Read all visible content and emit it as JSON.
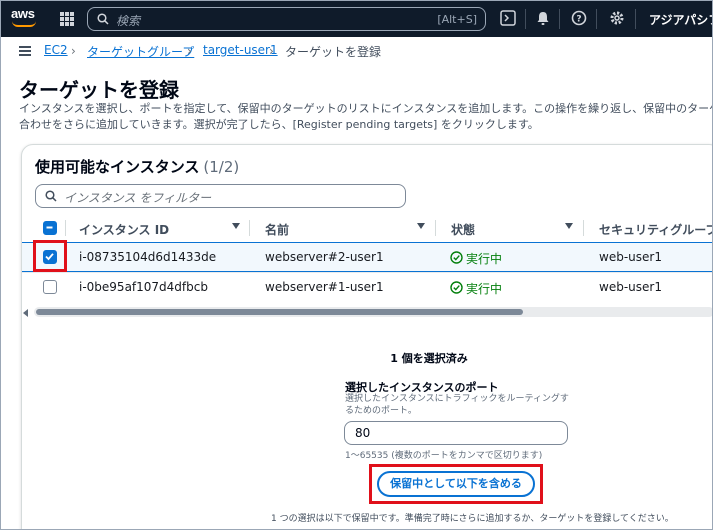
{
  "nav": {
    "logo": "aws",
    "search_placeholder": "検索",
    "search_shortcut": "[Alt+S]",
    "region": "アジアパシフィ"
  },
  "breadcrumb": [
    "EC2",
    "ターゲットグループ",
    "target-user1",
    "ターゲットを登録"
  ],
  "page": {
    "title": "ターゲットを登録",
    "desc_line1": "インスタンスを選択し、ポートを指定して、保留中のターゲットのリストにインスタンスを追加します。この操作を繰り返し、保留中のターゲットの",
    "desc_line2": "合わせをさらに追加していきます。選択が完了したら、[Register pending targets] をクリックします。"
  },
  "panel": {
    "title": "使用可能なインスタンス",
    "count": "(1/2)",
    "filter_placeholder": "インスタンス をフィルター"
  },
  "table": {
    "headers": [
      "インスタンス ID",
      "名前",
      "状態",
      "セキュリティグループ"
    ],
    "rows": [
      {
        "id": "i-08735104d6d1433de",
        "name": "webserver#2-user1",
        "state": "実行中",
        "sg": "web-user1",
        "selected": true
      },
      {
        "id": "i-0be95af107d4dfbcb",
        "name": "webserver#1-user1",
        "state": "実行中",
        "sg": "web-user1",
        "selected": false
      }
    ]
  },
  "selection": {
    "count_text": "1 個を選択済み",
    "port_label": "選択したインスタンスのポート",
    "port_desc": "選択したインスタンスにトラフィックをルーティングするためのポート。",
    "port_value": "80",
    "port_hint": "1〜65535 (複数のポートをカンマで区切ります)",
    "include_button": "保留中として以下を含める",
    "footer_note": "1 つの選択は以下で保留中です。準備完了時にさらに追加するか、ターゲットを登録してください。"
  },
  "colors": {
    "nav_bg": "#0f1b2a",
    "link": "#0972d3",
    "success": "#037f0c",
    "highlight": "#e0101a"
  }
}
